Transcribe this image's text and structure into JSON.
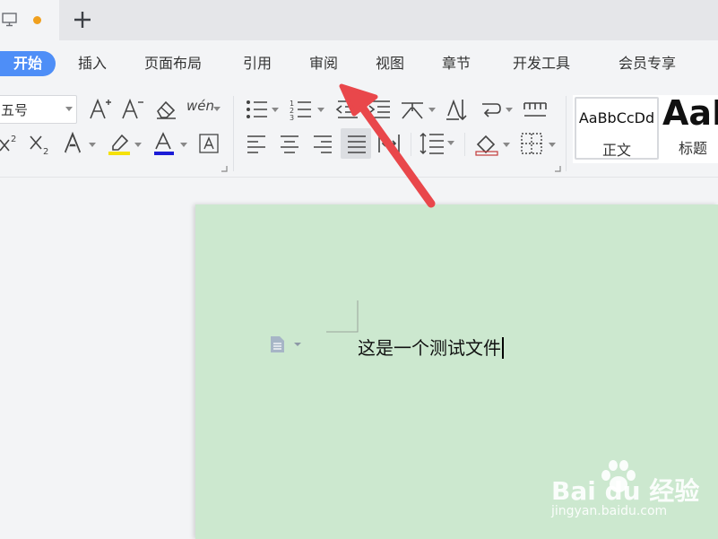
{
  "tabs": {
    "new_tab_label": "+"
  },
  "menu": {
    "items": [
      {
        "label": "开始",
        "active": true
      },
      {
        "label": "插入"
      },
      {
        "label": "页面布局"
      },
      {
        "label": "引用"
      },
      {
        "label": "审阅"
      },
      {
        "label": "视图"
      },
      {
        "label": "章节"
      },
      {
        "label": "开发工具"
      },
      {
        "label": "会员专享"
      }
    ]
  },
  "toolbar": {
    "font_size": "五号",
    "pinyin_label": "wén",
    "styles": [
      {
        "preview": "AaBbCcDd",
        "name": "正文"
      },
      {
        "preview": "AaB",
        "name": "标题"
      }
    ]
  },
  "document": {
    "text": "这是一个测试文件"
  },
  "watermark": {
    "logo": "Bai du 经验",
    "url": "jingyan.baidu.com"
  },
  "colors": {
    "accent": "#4e8ef7",
    "page_background": "#cce8cf",
    "highlight": "#f5e10a",
    "font_color": "#1c1cd6",
    "arrow": "#e9474b",
    "unsaved_dot": "#f0a01e"
  }
}
